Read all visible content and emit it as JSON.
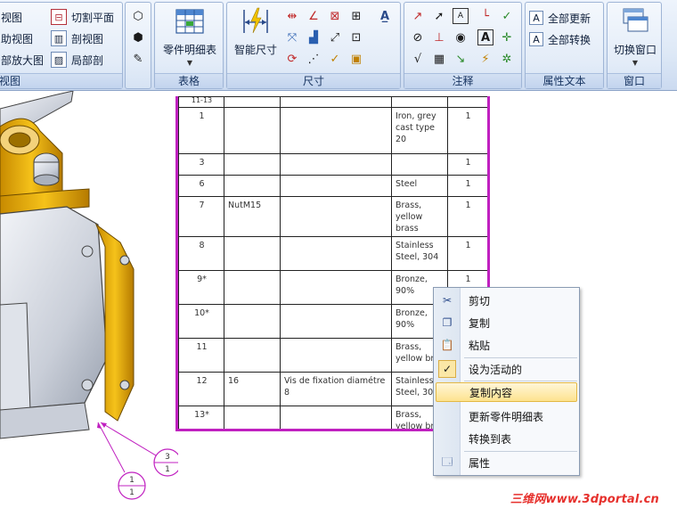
{
  "ribbon": {
    "view_group": {
      "label": "视图",
      "items": [
        "视图",
        "助视图",
        "部放大图"
      ],
      "items2": [
        "切割平面",
        "剖视图",
        "局部剖"
      ]
    },
    "table_group": {
      "label": "表格",
      "button": "零件明细表"
    },
    "dim_group": {
      "label": "尺寸",
      "button": "智能尺寸"
    },
    "annot_group": {
      "label": "注释"
    },
    "attr_group": {
      "label": "属性文本",
      "items": [
        "全部更新",
        "全部转换"
      ]
    },
    "window_group": {
      "label": "窗口",
      "button": "切换窗口"
    }
  },
  "balloons": [
    {
      "top": "3",
      "bottom": "1"
    },
    {
      "top": "1",
      "bottom": "1"
    }
  ],
  "table": {
    "header_partial": "11-13",
    "rows": [
      {
        "item": "1",
        "name": "",
        "desc": "",
        "material": "Iron, grey cast type 20",
        "qty": "1"
      },
      {
        "item": "3",
        "name": "",
        "desc": "",
        "material": "",
        "qty": "1"
      },
      {
        "item": "6",
        "name": "",
        "desc": "",
        "material": "Steel",
        "qty": "1"
      },
      {
        "item": "7",
        "name": "NutM15",
        "desc": "",
        "material": "Brass, yellow brass",
        "qty": "1"
      },
      {
        "item": "8",
        "name": "",
        "desc": "",
        "material": "Stainless Steel, 304",
        "qty": "1"
      },
      {
        "item": "9*",
        "name": "",
        "desc": "",
        "material": "Bronze, 90%",
        "qty": "1"
      },
      {
        "item": "10*",
        "name": "",
        "desc": "",
        "material": "Bronze, 90%",
        "qty": ""
      },
      {
        "item": "11",
        "name": "",
        "desc": "",
        "material": "Brass, yellow bras",
        "qty": ""
      },
      {
        "item": "12",
        "name": "16",
        "desc": "Vis de fixation diamétre 8",
        "material": "Stainless Steel, 304",
        "qty": ""
      },
      {
        "item": "13*",
        "name": "",
        "desc": "",
        "material": "Brass, yellow bras",
        "qty": ""
      }
    ]
  },
  "context_menu": {
    "items": [
      {
        "label": "剪切",
        "icon": "scissors-icon"
      },
      {
        "label": "复制",
        "icon": "copy-icon"
      },
      {
        "label": "粘贴",
        "icon": "paste-icon"
      },
      {
        "label": "设为活动的",
        "icon": "check-icon"
      },
      {
        "label": "复制内容",
        "icon": ""
      },
      {
        "label": "更新零件明细表",
        "icon": ""
      },
      {
        "label": "转换到表",
        "icon": ""
      },
      {
        "label": "属性",
        "icon": "properties-icon"
      }
    ],
    "highlighted_index": 4
  },
  "watermark": "三维网www.3dportal.cn",
  "colors": {
    "table_border": "#c020c0",
    "balloon": "#c020c0",
    "model_gold": "#e0a800",
    "menu_highlight": "#fde38f"
  }
}
